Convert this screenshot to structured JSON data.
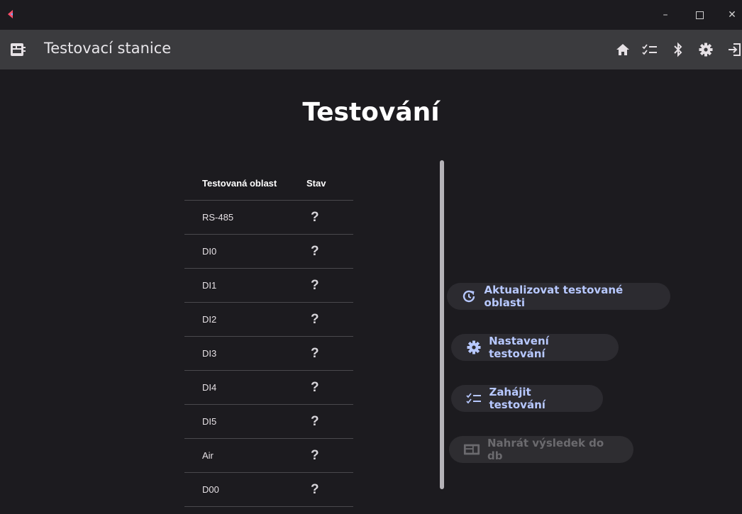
{
  "appbar": {
    "title": "Testovací stanice"
  },
  "main": {
    "heading": "Testování",
    "table": {
      "headers": {
        "area": "Testovaná oblast",
        "status": "Stav"
      },
      "rows": [
        {
          "area": "RS-485",
          "status": "?"
        },
        {
          "area": "DI0",
          "status": "?"
        },
        {
          "area": "DI1",
          "status": "?"
        },
        {
          "area": "DI2",
          "status": "?"
        },
        {
          "area": "DI3",
          "status": "?"
        },
        {
          "area": "DI4",
          "status": "?"
        },
        {
          "area": "DI5",
          "status": "?"
        },
        {
          "area": "Air",
          "status": "?"
        },
        {
          "area": "D00",
          "status": "?"
        }
      ]
    },
    "actions": {
      "refresh": "Aktualizovat testované oblasti",
      "settings": "Nastavení testování",
      "start": "Zahájit testování",
      "upload": "Nahrát výsledek do db"
    }
  },
  "colors": {
    "background": "#1c1b1f",
    "appbar": "#3b3b3e",
    "button_text": "#b7c8ff",
    "disabled_text": "#6b6a6e"
  },
  "icons": {
    "appbar": [
      "home-icon",
      "checklist-icon",
      "bluetooth-icon",
      "settings-icon",
      "logout-icon"
    ]
  }
}
